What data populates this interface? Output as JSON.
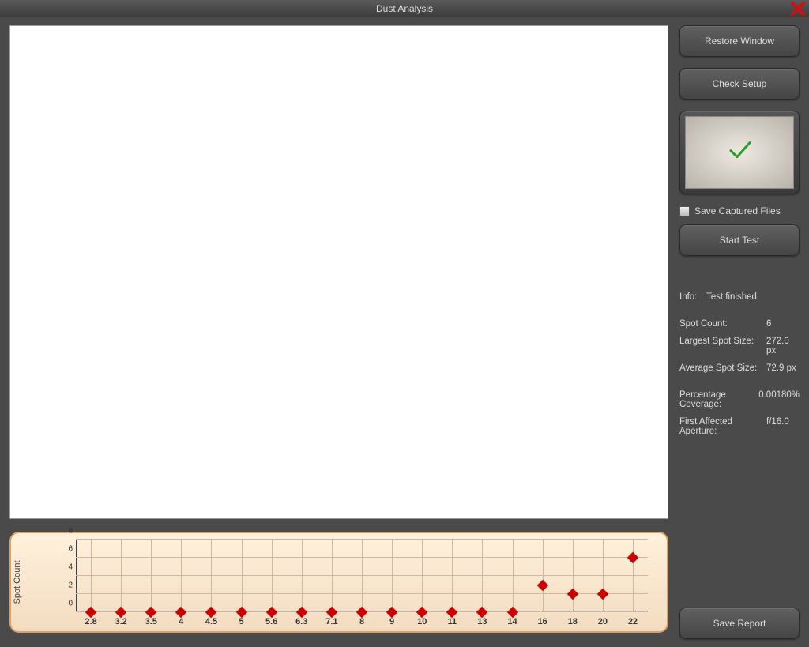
{
  "window": {
    "title": "Dust Analysis"
  },
  "buttons": {
    "restore": "Restore Window",
    "check_setup": "Check Setup",
    "start_test": "Start Test",
    "save_report": "Save Report"
  },
  "checkbox": {
    "save_captured": "Save Captured Files"
  },
  "info": {
    "info_label": "Info:",
    "info_value": "Test finished",
    "rows": [
      {
        "k": "Spot Count:",
        "v": "6"
      },
      {
        "k": "Largest Spot Size:",
        "v": "272.0 px"
      },
      {
        "k": "Average Spot Size:",
        "v": "72.9 px"
      }
    ],
    "rows2": [
      {
        "k": "Percentage Coverage:",
        "v": "0.00180%"
      },
      {
        "k": "First Affected Aperture:",
        "v": "f/16.0"
      }
    ]
  },
  "chart_data": {
    "type": "scatter",
    "ylabel": "Spot Count",
    "xlabel": "",
    "ylim": [
      0,
      8
    ],
    "yticks": [
      0,
      2,
      4,
      6,
      8
    ],
    "categories": [
      "2.8",
      "3.2",
      "3.5",
      "4",
      "4.5",
      "5",
      "5.6",
      "6.3",
      "7.1",
      "8",
      "9",
      "10",
      "11",
      "13",
      "14",
      "16",
      "18",
      "20",
      "22"
    ],
    "values": [
      0,
      0,
      0,
      0,
      0,
      0,
      0,
      0,
      0,
      0,
      0,
      0,
      0,
      0,
      0,
      3,
      2,
      2,
      6
    ]
  }
}
